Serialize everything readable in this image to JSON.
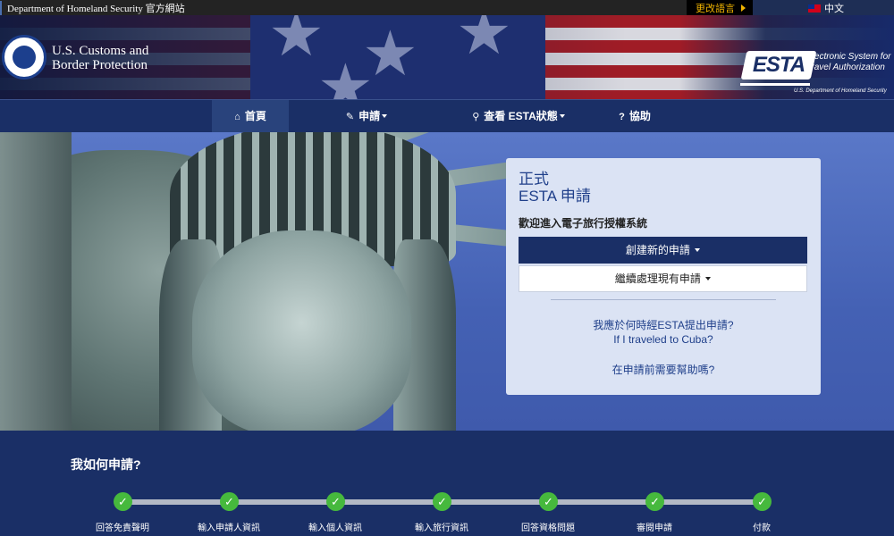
{
  "topbar": {
    "official_site": "Department of Homeland Security 官方網站",
    "change_language": "更改語言",
    "current_language": "中文"
  },
  "header": {
    "agency_line1": "U.S. Customs and",
    "agency_line2": "Border Protection",
    "esta_logo": "ESTA",
    "esta_line1": "Electronic System for",
    "esta_line2": "Travel Authorization",
    "esta_dept": "U.S. Department of Homeland Security"
  },
  "nav": {
    "items": [
      {
        "label": "首頁",
        "icon": "home-icon",
        "active": true
      },
      {
        "label": "申請",
        "icon": "pencil-icon",
        "dropdown": true
      },
      {
        "label": "查看 ESTA狀態",
        "icon": "search-icon",
        "dropdown": true
      },
      {
        "label": "協助",
        "icon": "help-icon"
      }
    ]
  },
  "card": {
    "title_line1": "正式",
    "title_line2": "ESTA 申請",
    "welcome": "歡迎進入電子旅行授權系統",
    "create_new": "創建新的申請",
    "continue_existing": "繼續處理現有申請",
    "when_to_apply": "我應於何時經ESTA提出申請?",
    "cuba": "If I traveled to Cuba?",
    "need_help": "在申請前需要幫助嗎?"
  },
  "howto": {
    "title": "我如何申請?",
    "steps": [
      "回答免責聲明",
      "輸入申請人資訊",
      "輸入個人資訊",
      "輸入旅行資訊",
      "回答資格問題",
      "審閱申請",
      "付款"
    ]
  },
  "colors": {
    "navy": "#1a2f66",
    "link_blue": "#1f3f8a",
    "accent_gold": "#f0b400",
    "step_green": "#46b93d"
  }
}
